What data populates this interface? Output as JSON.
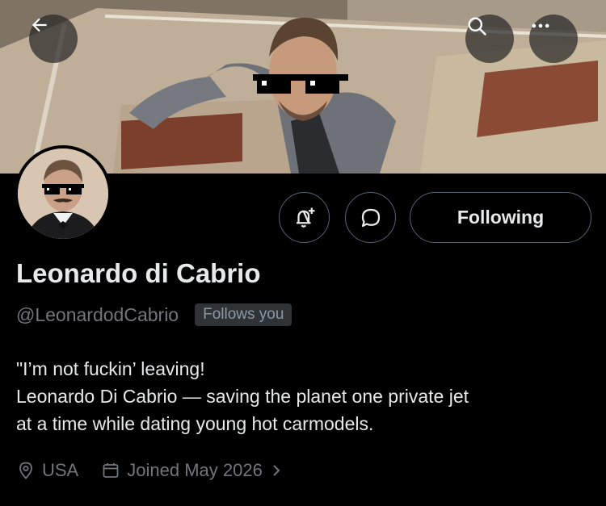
{
  "header": {
    "back_icon": "arrow-left-icon",
    "search_icon": "search-icon",
    "more_icon": "more-horizontal-icon"
  },
  "profile": {
    "display_name": "Leonardo di Cabrio",
    "handle": "@LeonardodCabrio",
    "follows_you_badge": "Follows you",
    "bio_lines": [
      "\"I’m not fuckin’ leaving!",
      "Leonardo Di Cabrio — saving the planet one private jet",
      "at a time while dating young hot carmodels."
    ],
    "location": "USA",
    "joined": "Joined May 2026"
  },
  "actions": {
    "notify_icon": "bell-plus-icon",
    "message_icon": "message-icon",
    "following_label": "Following"
  },
  "colors": {
    "background": "#000000",
    "text_primary": "#e7e9ea",
    "text_secondary": "#71767b",
    "border": "#536471"
  }
}
